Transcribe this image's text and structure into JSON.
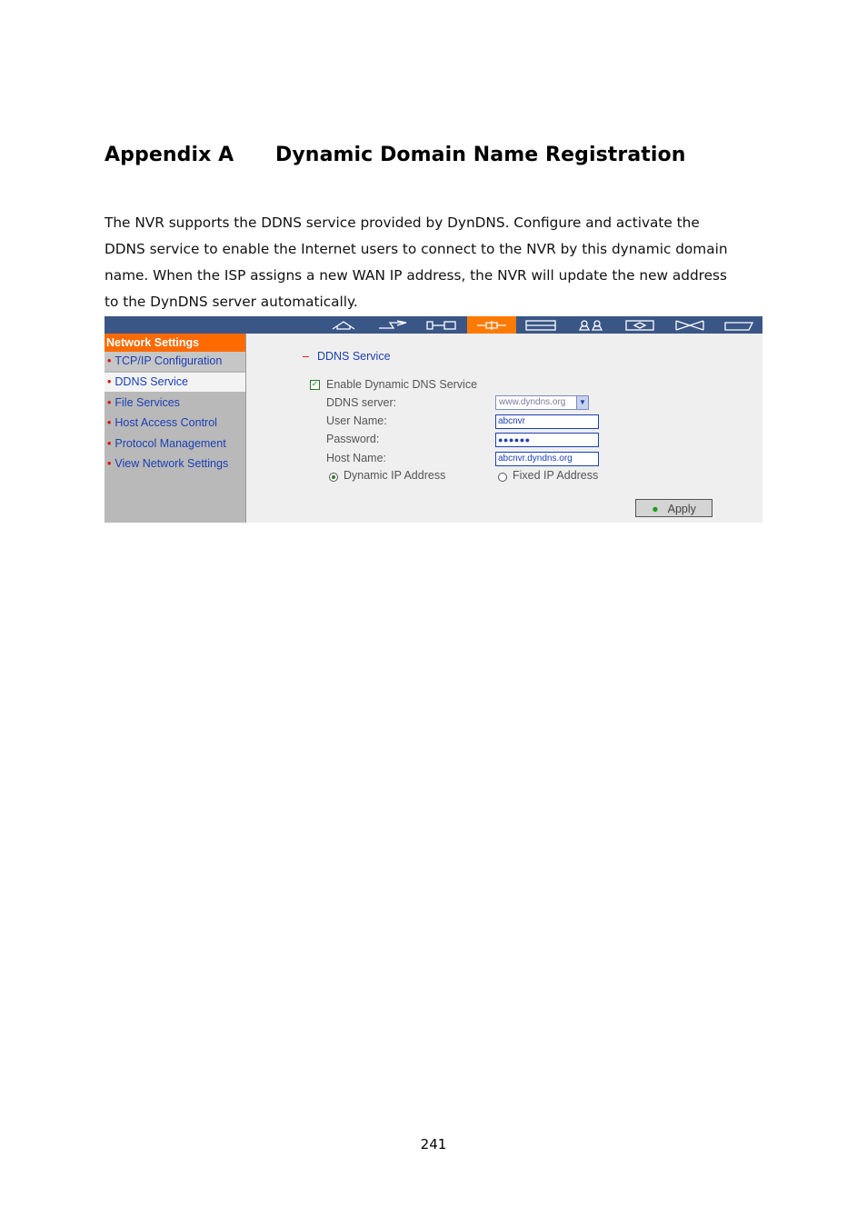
{
  "heading": {
    "appendix": "Appendix A",
    "title": "Dynamic Domain Name Registration"
  },
  "paragraph": {
    "lines": [
      "The NVR supports the DDNS service provided by DynDNS.   Configure and activate the",
      "DDNS service to enable the Internet users to connect to the NVR by this dynamic domain",
      "name.   When the ISP assigns a new WAN IP address, the NVR will update the new address",
      "to the DynDNS server automatically."
    ]
  },
  "screenshot": {
    "toolbar": {
      "icons": [
        "home-icon",
        "quick-config-icon",
        "system-icon",
        "network-icon",
        "device-icon",
        "users-icon",
        "share-icon",
        "tools-icon",
        "status-icon"
      ],
      "active_index": 3,
      "colors": {
        "bar": "#3a5687",
        "active": "#ff7a00"
      }
    },
    "sidebar": {
      "title": "Network Settings",
      "items": [
        {
          "label": "TCP/IP Configuration"
        },
        {
          "label": "DDNS Service"
        },
        {
          "label": "File Services"
        },
        {
          "label": "Host Access Control"
        },
        {
          "label": "Protocol Management"
        },
        {
          "label": "View Network Settings"
        }
      ],
      "active_index": 1,
      "bullet": "•"
    },
    "form": {
      "section_dash": "–",
      "section_title": "DDNS Service",
      "enable_label": "Enable Dynamic DNS Service",
      "enable_checked": true,
      "ddns_server_label": "DDNS server:",
      "ddns_server_value": "www.dyndns.org",
      "user_name_label": "User Name:",
      "user_name_value": "abcnvr",
      "password_label": "Password:",
      "password_value": "●●●●●●",
      "host_name_label": "Host Name:",
      "host_name_value": "abcnvr.dyndns.org",
      "dynamic_ip_label": "Dynamic IP Address",
      "fixed_ip_label": "Fixed IP Address",
      "selected_ip_mode": "Dynamic IP Address",
      "apply_label": "Apply"
    }
  },
  "page_number": "241"
}
